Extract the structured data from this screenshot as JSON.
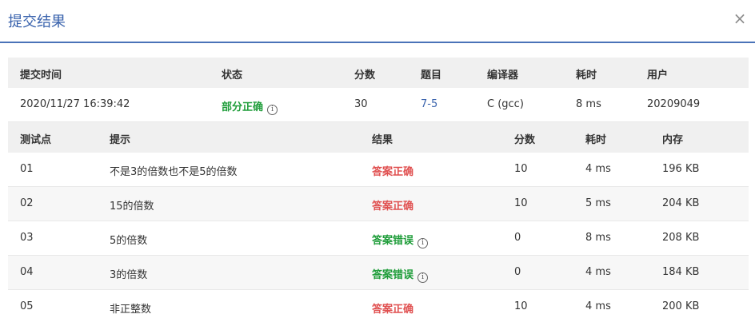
{
  "dialog": {
    "title": "提交结果",
    "close_glyph": "×"
  },
  "submission": {
    "headers": [
      "提交时间",
      "状态",
      "分数",
      "题目",
      "编译器",
      "耗时",
      "用户"
    ],
    "time": "2020/11/27 16:39:42",
    "status": "部分正确",
    "status_color": "#1f9d3a",
    "score": "30",
    "problem": "7-5",
    "compiler": "C (gcc)",
    "elapsed": "8 ms",
    "user": "20209049"
  },
  "testcases": {
    "headers": [
      "测试点",
      "提示",
      "结果",
      "分数",
      "耗时",
      "内存"
    ],
    "rows": [
      {
        "id": "01",
        "hint": "不是3的倍数也不是5的倍数",
        "result": "答案正确",
        "score": "10",
        "time": "4 ms",
        "memory": "196 KB"
      },
      {
        "id": "02",
        "hint": "15的倍数",
        "result": "答案正确",
        "score": "10",
        "time": "5 ms",
        "memory": "204 KB"
      },
      {
        "id": "03",
        "hint": "5的倍数",
        "result": "答案错误",
        "score": "0",
        "time": "8 ms",
        "memory": "208 KB"
      },
      {
        "id": "04",
        "hint": "3的倍数",
        "result": "答案错误",
        "score": "0",
        "time": "4 ms",
        "memory": "184 KB"
      },
      {
        "id": "05",
        "hint": "非正整数",
        "result": "答案正确",
        "score": "10",
        "time": "4 ms",
        "memory": "200 KB"
      }
    ]
  },
  "colors": {
    "correct": "#e05050",
    "wrong": "#1f9d3a",
    "accent": "#3a63ad"
  },
  "icons": {
    "info": "info-icon",
    "close": "close-icon"
  }
}
